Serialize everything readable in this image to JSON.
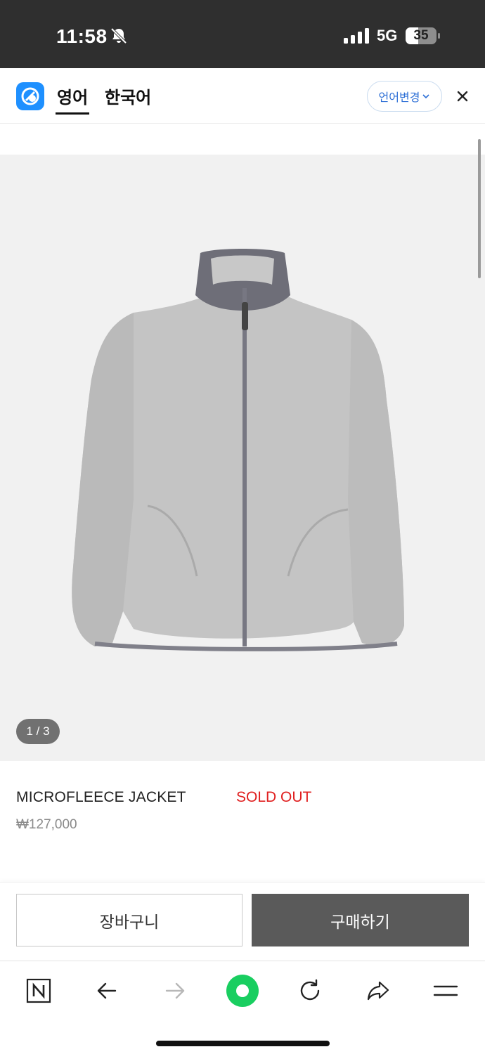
{
  "status_bar": {
    "time": "11:58",
    "network": "5G",
    "battery": "35",
    "icons": [
      "bell-off-icon",
      "signal-icon",
      "battery-icon"
    ]
  },
  "translation_header": {
    "tabs": [
      {
        "label": "영어",
        "active": true
      },
      {
        "label": "한국어",
        "active": false
      }
    ],
    "language_change_label": "언어변경",
    "icons": [
      "papago-logo-icon",
      "chevron-down-icon",
      "close-icon"
    ]
  },
  "product": {
    "image_indicator": "1 / 3",
    "name": "MICROFLEECE JACKET",
    "status": "SOLD OUT",
    "price": "₩127,000"
  },
  "actions": {
    "cart_label": "장바구니",
    "buy_label": "구매하기"
  },
  "browser_bar": {
    "icons": [
      "naver-n-icon",
      "back-arrow-icon",
      "forward-arrow-icon",
      "green-dot-icon",
      "refresh-icon",
      "share-icon",
      "menu-icon"
    ]
  },
  "colors": {
    "status_bar_bg": "#2f2f2f",
    "accent_blue": "#2d6fd6",
    "sold_out_red": "#e02020",
    "buy_button_bg": "#5a5a5a",
    "green_dot": "#19ce60",
    "image_bg": "#f1f1f1"
  }
}
